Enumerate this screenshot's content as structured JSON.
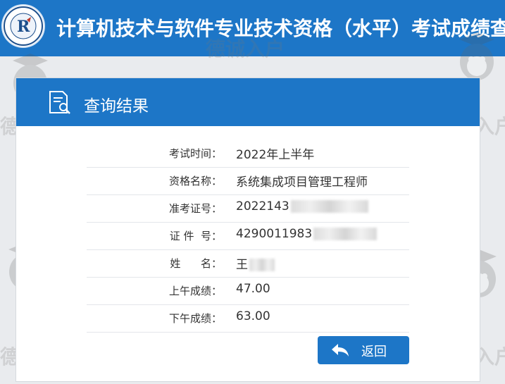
{
  "header": {
    "title": "计算机技术与软件专业技术资格（水平）考试成绩查询"
  },
  "watermark": {
    "text": "德诚入户"
  },
  "panel": {
    "title": "查询结果",
    "rows": [
      {
        "label": "考试时间：",
        "value": "2022年上半年"
      },
      {
        "label": "资格名称：",
        "value": "系统集成项目管理工程师"
      },
      {
        "label": "准考证号：",
        "value": "2022143"
      },
      {
        "label": "证 件  号：",
        "value": "4290011983"
      },
      {
        "label": "姓      名：",
        "value": "王"
      },
      {
        "label": "上午成绩：",
        "value": "47.00"
      },
      {
        "label": "下午成绩：",
        "value": "63.00"
      }
    ],
    "back_label": "返回"
  },
  "colors": {
    "primary": "#1d76c7",
    "background": "#e9ebee"
  }
}
